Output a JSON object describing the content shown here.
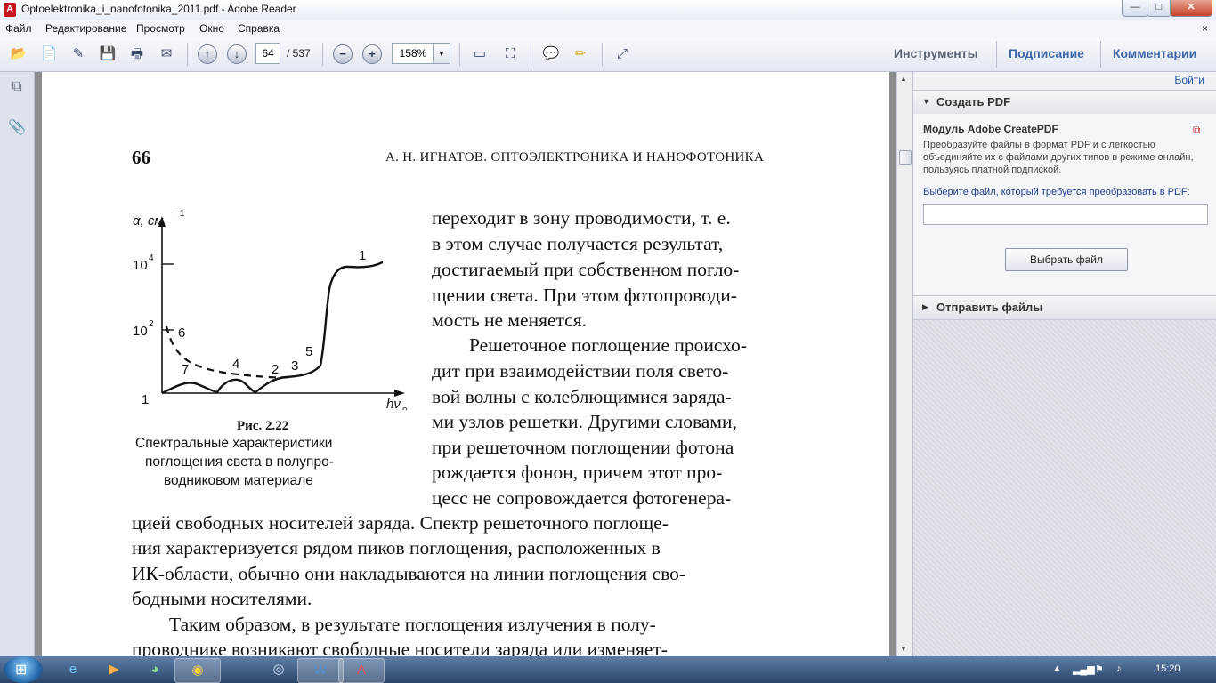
{
  "window": {
    "title": "Optoelektronika_i_nanofotonika_2011.pdf - Adobe Reader",
    "app_icon": "A",
    "minimize_label": "—",
    "maximize_label": "□",
    "close_label": "✕"
  },
  "menu": {
    "items": [
      "Файл",
      "Редактирование",
      "Просмотр",
      "Окно",
      "Справка"
    ],
    "close_doc": "×"
  },
  "toolbar": {
    "page_current": "64",
    "page_total": "/ 537",
    "zoom": "158%",
    "zoom_dropdown": "▼",
    "zoom_out": "−",
    "zoom_in": "+",
    "prev_page": "↑",
    "next_page": "↓",
    "tabs": [
      "Инструменты",
      "Подписание",
      "Комментарии"
    ]
  },
  "document": {
    "page_number": "66",
    "running_head": "А. Н. ИГНАТОВ. ОПТОЭЛЕКТРОНИКА И НАНОФОТОНИКА",
    "figure": {
      "y_label": "α, см",
      "y_label_exp": "−1",
      "tick_1e4": "10",
      "tick_1e4_exp": "4",
      "tick_1e2": "10",
      "tick_1e2_exp": "2",
      "tick_1": "1",
      "x_label": "hν",
      "x_label_sub": "0",
      "curve_labels": [
        "1",
        "2",
        "3",
        "4",
        "5",
        "6",
        "7"
      ],
      "caption_title": "Рис. 2.22",
      "caption_lines": [
        "Спектральные характеристики",
        "поглощения света в полупро-",
        "водниковом материале"
      ]
    },
    "right_column_lines": [
      "переходит в зону проводимости, т. е.",
      "в этом случае получается результат,",
      "достигаемый при собственном погло-",
      "щении света. При этом фотопроводи-",
      "мость не меняется.",
      "Решеточное поглощение происхо-",
      "дит при взаимодействии поля свето-",
      "вой волны с колеблющимися заряда-",
      "ми узлов решетки. Другими словами,",
      "при решеточном поглощении фотона",
      "рождается фонон, причем этот про-",
      "цесс не сопровождается фотогенера-"
    ],
    "full_width_lines": [
      "цией свободных носителей заряда. Спектр решеточного поглоще-",
      "ния характеризуется рядом пиков поглощения, расположенных в",
      "ИК-области, обычно они накладываются на линии поглощения сво-",
      "бодными носителями.",
      "Таким образом, в результате поглощения излучения в полу-",
      "проводнике возникают свободные носители заряда или изменяет-"
    ]
  },
  "right_panel": {
    "exit_label": "Войти",
    "section1_title": "Создать PDF",
    "section1_icon": "▼",
    "module_title": "Модуль Adobe CreatePDF",
    "module_desc": "Преобразуйте файлы в формат PDF и с легкостью объединяйте их с файлами других типов в режиме онлайн, пользуясь платной подпиской.",
    "file_prompt": "Выберите файл, который требуется преобразовать в PDF:",
    "file_button": "Выбрать файл",
    "section2_title": "Отправить файлы",
    "section2_icon": "▶"
  },
  "taskbar": {
    "clock": "15:20",
    "apps": [
      "ie-icon",
      "media-player-icon",
      "game-icon",
      "chrome-icon",
      "app-icon",
      "word-icon",
      "adobe-reader-icon"
    ]
  }
}
